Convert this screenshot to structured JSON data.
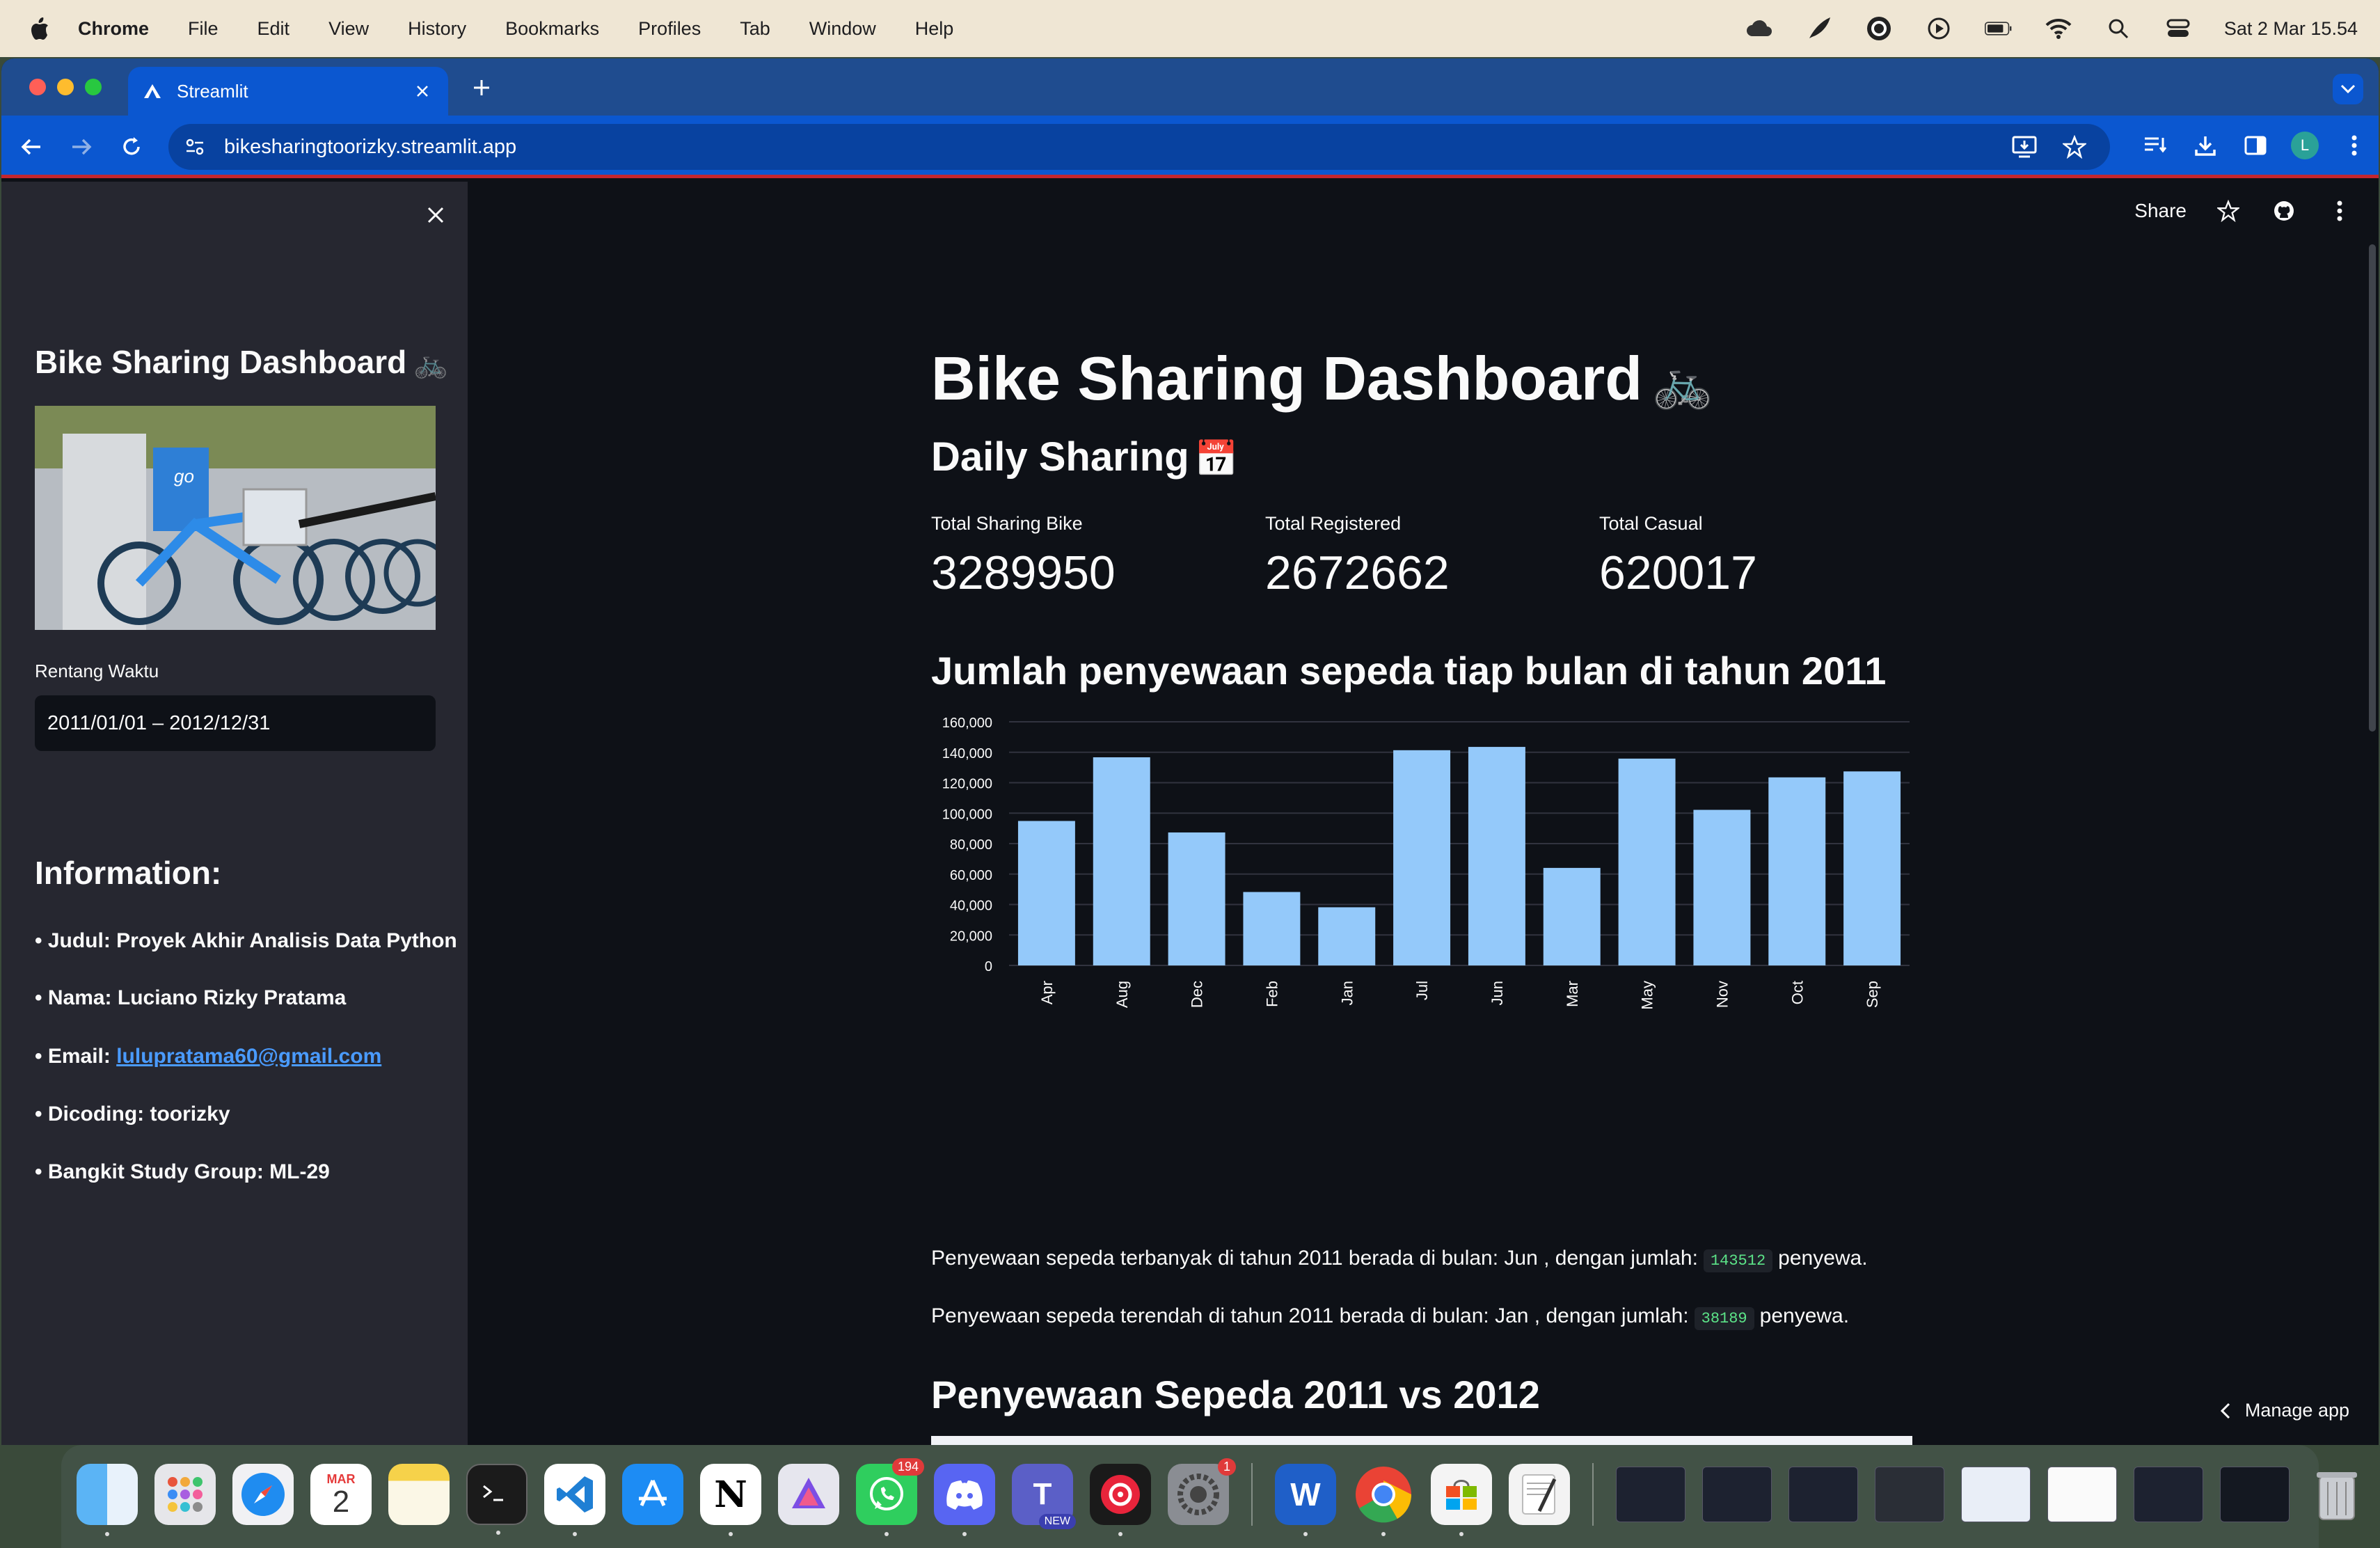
{
  "menubar": {
    "app_name": "Chrome",
    "items": [
      "File",
      "Edit",
      "View",
      "History",
      "Bookmarks",
      "Profiles",
      "Tab",
      "Window",
      "Help"
    ],
    "clock": "Sat 2 Mar  15.54"
  },
  "browser": {
    "tab_title": "Streamlit",
    "url": "bikesharingtoorizky.streamlit.app",
    "profile_initial": "L"
  },
  "sidebar": {
    "title": "Bike Sharing Dashboard",
    "title_emoji": "🚲",
    "date_label": "Rentang Waktu",
    "date_value": "2011/01/01 – 2012/12/31",
    "info_title": "Information:",
    "info": {
      "judul": "• Judul: Proyek Akhir Analisis Data Python",
      "nama": "• Nama: Luciano Rizky Pratama",
      "email_prefix": "• Email: ",
      "email": "lulupratama60@gmail.com",
      "dicoding": "• Dicoding: toorizky",
      "bangkit": "• Bangkit Study Group: ML-29"
    }
  },
  "header": {
    "share_label": "Share"
  },
  "main": {
    "title": "Bike Sharing Dashboard",
    "title_emoji": "🚲",
    "subtitle": "Daily Sharing",
    "subtitle_emoji": "📅",
    "metrics": [
      {
        "label": "Total Sharing Bike",
        "value": "3289950"
      },
      {
        "label": "Total Registered",
        "value": "2672662"
      },
      {
        "label": "Total Casual",
        "value": "620017"
      }
    ],
    "chart_heading": "Jumlah penyewaan sepeda tiap bulan di tahun 2011",
    "max_text": "Penyewaan sepeda terbanyak di tahun 2011 berada di bulan: Jun , dengan jumlah:",
    "max_value": "143512",
    "min_text": "Penyewaan sepeda terendah di tahun 2011 berada di bulan: Jan , dengan jumlah:",
    "min_value": "38189",
    "suffix": "penyewa.",
    "section2_heading": "Penyewaan Sepeda 2011 vs 2012",
    "manage_app": "Manage app"
  },
  "chart_data": {
    "type": "bar",
    "title": "",
    "xlabel": "",
    "ylabel": "",
    "categories": [
      "Apr",
      "Aug",
      "Dec",
      "Feb",
      "Jan",
      "Jul",
      "Jun",
      "Mar",
      "May",
      "Nov",
      "Oct",
      "Sep"
    ],
    "values": [
      94870,
      136691,
      87323,
      48215,
      38189,
      141341,
      143512,
      64045,
      135821,
      102167,
      123511,
      127418
    ],
    "yticks": [
      "0",
      "20,000",
      "40,000",
      "60,000",
      "80,000",
      "100,000",
      "120,000",
      "140,000",
      "160,000"
    ],
    "ylim": [
      0,
      160000
    ],
    "grid": true,
    "bar_color": "#94c9fa"
  },
  "dock": {
    "apps": [
      "finder",
      "launchpad",
      "safari",
      "calendar",
      "notes",
      "terminal",
      "vscode",
      "app-store",
      "notion",
      "affinity",
      "whatsapp",
      "discord",
      "teams",
      "music",
      "system-settings",
      "word",
      "chrome",
      "microsoft-store",
      "textedit"
    ],
    "calendar_month": "MAR",
    "calendar_day": "2",
    "whatsapp_badge": "194",
    "settings_badge": "1",
    "teams_badge": "NEW"
  },
  "colors": {
    "app_bg": "#0e1117",
    "sidebar_bg": "#262730",
    "chrome_blue": "#0b57d0",
    "link": "#4a9bff",
    "code_green": "#5ce488"
  }
}
